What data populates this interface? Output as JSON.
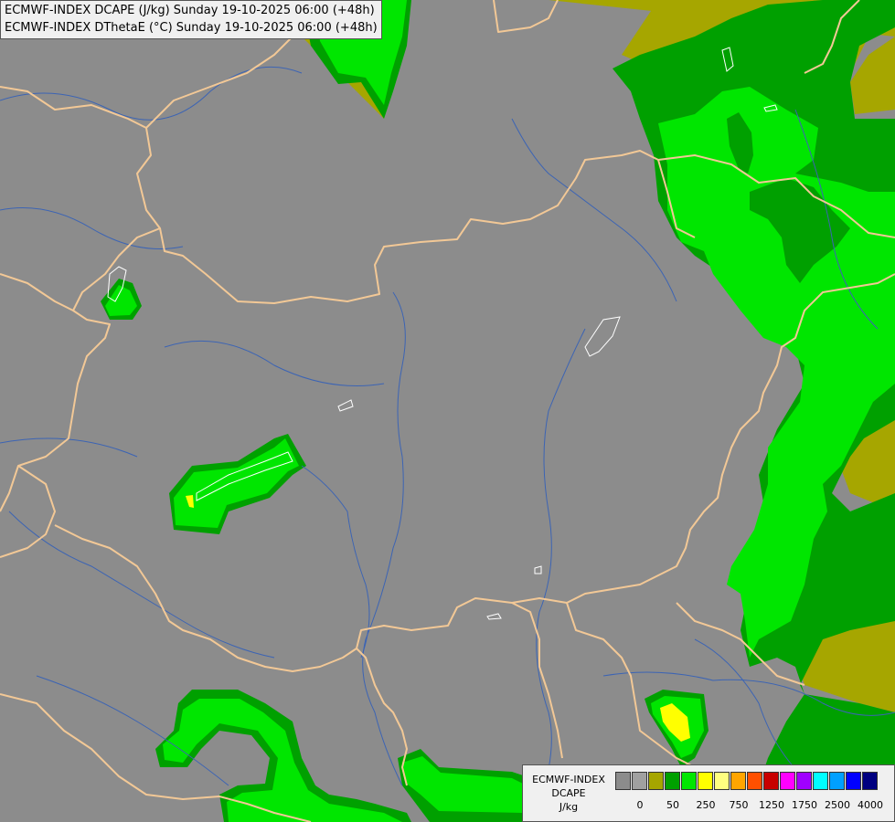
{
  "header": {
    "line1": "ECMWF-INDEX DCAPE (J/kg) Sunday 19-10-2025 06:00 (+48h)",
    "line2": "ECMWF-INDEX DThetaE (°C) Sunday 19-10-2025 06:00 (+48h)"
  },
  "legend": {
    "model": "ECMWF-INDEX",
    "parameter": "DCAPE",
    "unit": "J/kg",
    "colors": [
      "#8c8c8c",
      "#a0a0a0",
      "#a6a600",
      "#00a000",
      "#00e600",
      "#ffff00",
      "#ffff80",
      "#ffa500",
      "#ff5000",
      "#c80000",
      "#ff00ff",
      "#a000ff",
      "#00ffff",
      "#00a0ff",
      "#0000ff",
      "#000080"
    ],
    "ticks": [
      {
        "label": "0",
        "at": 1
      },
      {
        "label": "50",
        "at": 3
      },
      {
        "label": "250",
        "at": 5
      },
      {
        "label": "750",
        "at": 7
      },
      {
        "label": "1250",
        "at": 9
      },
      {
        "label": "1750",
        "at": 11
      },
      {
        "label": "2500",
        "at": 13
      },
      {
        "label": "4000",
        "at": 15
      }
    ]
  },
  "map_colors": {
    "background": "#8c8c8c",
    "level_50": "#a6a600",
    "level_100": "#00a000",
    "level_250": "#00e600",
    "level_500": "#ffff00",
    "borders": "#f2c896",
    "rivers": "#3c64b4",
    "lakes": "#ffffff"
  }
}
